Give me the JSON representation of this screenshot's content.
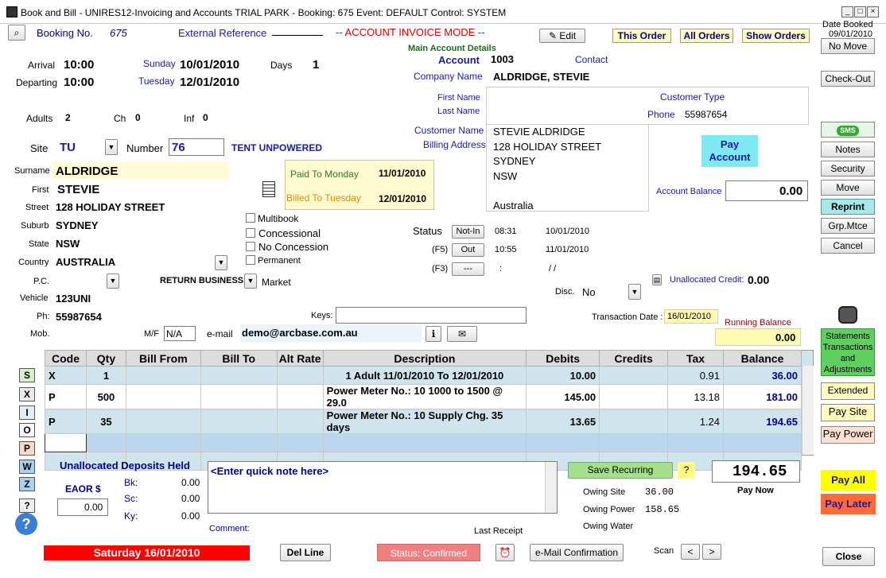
{
  "window": {
    "title": "Book and Bill - UNIRES12-Invoicing and Accounts TRIAL PARK - Booking: 675 Event: DEFAULT Control: SYSTEM"
  },
  "header": {
    "booking_label": "Booking No.",
    "booking_no": "675",
    "ext_ref_label": "External Reference",
    "mode": "-- ACCOUNT INVOICE MODE --",
    "edit_label": "Edit",
    "this_order": "This Order",
    "all_orders": "All Orders",
    "show_orders": "Show Orders",
    "date_booked_label": "Date Booked",
    "date_booked": "09/01/2010"
  },
  "stay": {
    "arrival_label": "Arrival",
    "arrival_time": "10:00",
    "arrival_day": "Sunday",
    "arrival_date": "10/01/2010",
    "departing_label": "Departing",
    "departing_time": "10:00",
    "departing_day": "Tuesday",
    "departing_date": "12/01/2010",
    "days_label": "Days",
    "days": "1",
    "adults_label": "Adults",
    "adults": "2",
    "ch_label": "Ch",
    "ch": "0",
    "inf_label": "Inf",
    "inf": "0",
    "site_label": "Site",
    "site": "TU",
    "number_label": "Number",
    "number": "76",
    "site_type": "TENT UNPOWERED"
  },
  "guest": {
    "surname_label": "Surname",
    "surname": "ALDRIDGE",
    "first_label": "First",
    "first": "STEVIE",
    "street_label": "Street",
    "street": "128 HOLIDAY STREET",
    "suburb_label": "Suburb",
    "suburb": "SYDNEY",
    "state_label": "State",
    "state": "NSW",
    "country_label": "Country",
    "country": "AUSTRALIA",
    "pc_label": "P.C.",
    "return_business": "RETURN BUSINESS",
    "market": "Market",
    "vehicle_label": "Vehicle",
    "vehicle": "123UNI",
    "ph_label": "Ph:",
    "ph": "55987654",
    "mob_label": "Mob.",
    "mf_label": "M/F",
    "mf": "N/A",
    "email_label": "e-mail",
    "email": "demo@arcbase.com.au",
    "keys_label": "Keys:"
  },
  "paid": {
    "paid_to_label": "Paid To",
    "paid_to_day": "Monday",
    "paid_to_date": "11/01/2010",
    "billed_to_label": "Billed To",
    "billed_to_day": "Tuesday",
    "billed_to_date": "12/01/2010"
  },
  "options": {
    "multibook": "Multibook",
    "concessional": "Concessional",
    "no_concession": "No Concession",
    "permanent": "Permanent"
  },
  "account": {
    "section_label": "Main Account Details",
    "account_label": "Account",
    "account": "1003",
    "contact_label": "Contact",
    "company_label": "Company Name",
    "company": "ALDRIDGE, STEVIE",
    "first_name_label": "First Name",
    "last_name_label": "Last Name",
    "customer_type_label": "Customer Type",
    "phone_label": "Phone",
    "phone": "55987654",
    "customer_name_label": "Customer Name",
    "billing_label": "Billing Address",
    "address_lines": [
      "STEVIE ALDRIDGE",
      "128 HOLIDAY STREET",
      "SYDNEY",
      "NSW",
      "",
      "Australia"
    ],
    "pay_account": "Pay Account",
    "balance_label": "Account Balance",
    "balance": "0.00",
    "unalloc_credit_label": "Unallocated Credit:",
    "unalloc_credit": "0.00"
  },
  "status": {
    "label": "Status",
    "rows": [
      {
        "key": "",
        "button": "Not-In",
        "time": "08:31",
        "date": "10/01/2010"
      },
      {
        "key": "(F5)",
        "button": "Out",
        "time": "10:55",
        "date": "11/01/2010"
      },
      {
        "key": "(F3)",
        "button": "---",
        "time": ":",
        "date": "/ /"
      }
    ],
    "disc_label": "Disc.",
    "disc": "No"
  },
  "transaction": {
    "date_label": "Transaction Date :",
    "date": "16/01/2010",
    "running_label": "Running Balance",
    "running": "0.00"
  },
  "grid": {
    "headers": [
      "Code",
      "Qty",
      "Bill From",
      "Bill To",
      "Alt Rate",
      "Description",
      "Debits",
      "Credits",
      "Tax",
      "Balance"
    ],
    "rows": [
      {
        "code": "X",
        "qty": "1",
        "desc": "1 Adult 11/01/2010 To 12/01/2010",
        "debits": "10.00",
        "credits": "",
        "tax": "0.91",
        "balance": "36.00"
      },
      {
        "code": "P",
        "qty": "500",
        "desc": "Power Meter No.: 10 1000 to 1500 @  29.0",
        "debits": "145.00",
        "credits": "",
        "tax": "13.18",
        "balance": "181.00"
      },
      {
        "code": "P",
        "qty": "35",
        "desc": "Power Meter No.: 10 Supply Chg. 35 days",
        "debits": "13.65",
        "credits": "",
        "tax": "1.24",
        "balance": "194.65"
      }
    ]
  },
  "left_codes": [
    "S",
    "X",
    "I",
    "O",
    "P",
    "W",
    "Z",
    "?"
  ],
  "side": {
    "no_move": "No Move",
    "check_out": "Check-Out",
    "sms": "SMS",
    "notes": "Notes",
    "security": "Security",
    "move": "Move",
    "reprint": "Reprint",
    "grp_mtce": "Grp.Mtce",
    "cancel": "Cancel",
    "statements": "Statements Transactions and Adjustments",
    "extended": "Extended",
    "pay_site": "Pay Site",
    "pay_power": "Pay Power",
    "pay_all": "Pay All",
    "pay_later": "Pay Later",
    "close": "Close"
  },
  "footer": {
    "unalloc_deposits": "Unallocated Deposits Held",
    "eaor_label": "EAOR $",
    "eaor": "0.00",
    "bk_label": "Bk:",
    "bk": "0.00",
    "sc_label": "Sc:",
    "sc": "0.00",
    "ky_label": "Ky:",
    "ky": "0.00",
    "note_placeholder": "<Enter quick note here>",
    "comment_label": "Comment:",
    "save_recurring": "Save Recurring",
    "total": "194.65",
    "pay_now": "Pay Now",
    "owing_site_label": "Owing Site",
    "owing_site": "36.00",
    "owing_power_label": "Owing Power",
    "owing_power": "158.65",
    "owing_water_label": "Owing Water",
    "last_receipt": "Last Receipt",
    "day_banner": "Saturday 16/01/2010",
    "del_line": "Del Line",
    "status_confirmed": "Status: Confirmed",
    "email_confirm": "e-Mail Confirmation",
    "scan_label": "Scan"
  }
}
